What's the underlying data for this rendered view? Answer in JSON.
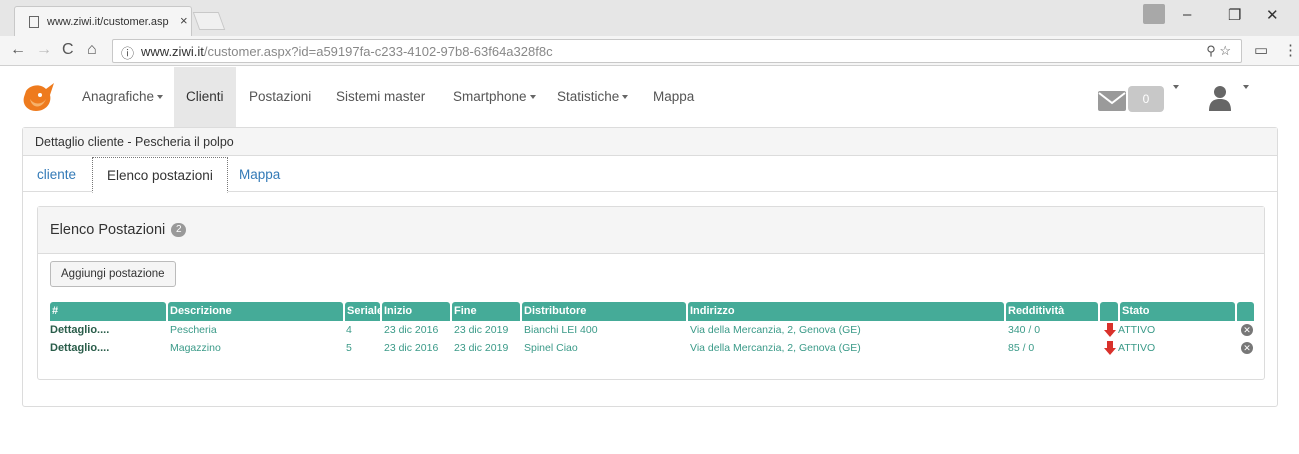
{
  "browser": {
    "tab_title": "www.ziwi.it/customer.asp",
    "tab_close": "×",
    "url_host": "www.ziwi.it",
    "url_rest": "/customer.aspx?id=a59197fa-c233-4102-97b8-63f64a328f8c"
  },
  "navbar": {
    "items": [
      {
        "label": "Anagrafiche",
        "dropdown": true
      },
      {
        "label": "Clienti",
        "dropdown": false,
        "active": true
      },
      {
        "label": "Postazioni",
        "dropdown": false
      },
      {
        "label": "Sistemi master",
        "dropdown": false
      },
      {
        "label": "Smartphone",
        "dropdown": true
      },
      {
        "label": "Statistiche",
        "dropdown": true
      },
      {
        "label": "Mappa",
        "dropdown": false
      }
    ],
    "mail_count": "0"
  },
  "panel": {
    "heading": "Dettaglio cliente - Pescheria il polpo",
    "tabs": [
      "cliente",
      "Elenco postazioni",
      "Mappa"
    ],
    "active_tab": "Elenco postazioni"
  },
  "postazioni": {
    "heading": "Elenco Postazioni",
    "count": "2",
    "add_button": "Aggiungi postazione",
    "columns": [
      "#",
      "Descrizione",
      "Seriale",
      "Inizio",
      "Fine",
      "Distributore",
      "Indirizzo",
      "Redditività",
      "",
      "Stato",
      ""
    ],
    "rows": [
      {
        "link": "Dettaglio....",
        "descrizione": "Pescheria",
        "seriale": "4",
        "inizio": "23 dic 2016",
        "fine": "23 dic 2019",
        "distributore": "Bianchi LEI 400",
        "indirizzo": "Via della Mercanzia, 2, Genova (GE)",
        "redditivita": "340 / 0",
        "stato": "ATTIVO"
      },
      {
        "link": "Dettaglio....",
        "descrizione": "Magazzino",
        "seriale": "5",
        "inizio": "23 dic 2016",
        "fine": "23 dic 2019",
        "distributore": "Spinel Ciao",
        "indirizzo": "Via della Mercanzia, 2, Genova (GE)",
        "redditivita": "85 / 0",
        "stato": "ATTIVO"
      }
    ]
  },
  "colors": {
    "header_teal": "#45ab98",
    "link_blue": "#337ab7",
    "arrow_red": "#d9312b"
  }
}
